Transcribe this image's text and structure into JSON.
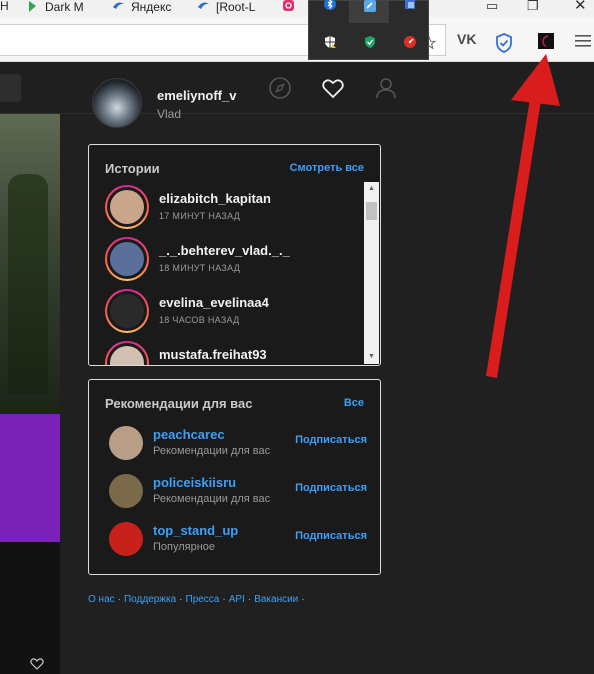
{
  "browser": {
    "tabs": [
      {
        "label": "Dark M",
        "icon": "dark-mode-tab-icon"
      },
      {
        "label": "Яндекс",
        "icon": "yandex-tab-icon"
      },
      {
        "label": "[Root-L",
        "icon": "root-tab-icon"
      },
      {
        "label": "",
        "icon": "instagram-tab-icon"
      }
    ],
    "tab_partial_left": "Н",
    "toolbar_icons": [
      "star-icon",
      "vk-icon",
      "shield-extension-icon",
      "dark-reader-extension-icon",
      "menu-icon"
    ],
    "vk_label": "VK"
  },
  "tray": {
    "icons": [
      "bluetooth-icon",
      "dark-reader-tray-icon",
      "network-icon",
      "defender-icon",
      "security-check-icon",
      "speedometer-icon"
    ]
  },
  "instagram": {
    "nav_icons": [
      "explore-compass-icon",
      "heart-icon",
      "profile-icon"
    ],
    "profile": {
      "username": "emeliynoff_v",
      "full_name": "Vlad"
    },
    "stories": {
      "title": "Истории",
      "see_all": "Смотреть все",
      "items": [
        {
          "name": "elizabitch_kapitan",
          "time": "17 МИНУТ НАЗАД",
          "color": "#c9a58a"
        },
        {
          "name": "_._.behterev_vlad._._",
          "time": "18 МИНУТ НАЗАД",
          "color": "#5a6f9a"
        },
        {
          "name": "evelina_evelinaa4",
          "time": "18 ЧАСОВ НАЗАД",
          "color": "#2a2a2a"
        },
        {
          "name": "mustafa.freihat93",
          "time": "",
          "color": "#d3c0b0"
        }
      ]
    },
    "recommendations": {
      "title": "Рекомендации для вас",
      "see_all": "Все",
      "items": [
        {
          "name": "peachcarec",
          "sub": "Рекомендации для вас",
          "action": "Подписаться",
          "color": "#b89e86"
        },
        {
          "name": "policeiskiisru",
          "sub": "Рекомендации для вас",
          "action": "Подписаться",
          "color": "#7a6a4a"
        },
        {
          "name": "top_stand_up",
          "sub": "Популярное",
          "action": "Подписаться",
          "color": "#c8211b"
        }
      ]
    },
    "footer_links": [
      "О нас",
      "Поддержка",
      "Пресса",
      "API",
      "Вакансии"
    ]
  },
  "colors": {
    "accent": "#3d9ff5",
    "annotation_arrow": "#d91c1c",
    "purple_post": "#7b22b8"
  }
}
